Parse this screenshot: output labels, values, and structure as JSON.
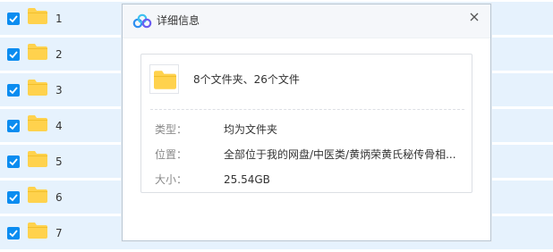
{
  "file_list": {
    "rows": [
      {
        "name": "1",
        "checked": true
      },
      {
        "name": "2",
        "checked": true
      },
      {
        "name": "3",
        "checked": true
      },
      {
        "name": "4",
        "checked": true
      },
      {
        "name": "5",
        "checked": true
      },
      {
        "name": "6",
        "checked": true
      },
      {
        "name": "7",
        "checked": true
      }
    ]
  },
  "dialog": {
    "title": "详细信息",
    "logo_icon": "baidu-netdisk-cloud-icon",
    "close_icon": "close-icon",
    "summary": "8个文件夹、26个文件",
    "details": [
      {
        "label": "类型：",
        "value": "均为文件夹"
      },
      {
        "label": "位置：",
        "value": "全部位于我的网盘/中医类/黄炳荣黄氏秘传骨相..."
      },
      {
        "label": "大小：",
        "value": "25.54GB"
      }
    ]
  },
  "colors": {
    "row_background": "#e6f2fd",
    "checkbox": "#0b8cf0",
    "folder": "#ffd24d",
    "header_background": "#f5f7fa"
  }
}
